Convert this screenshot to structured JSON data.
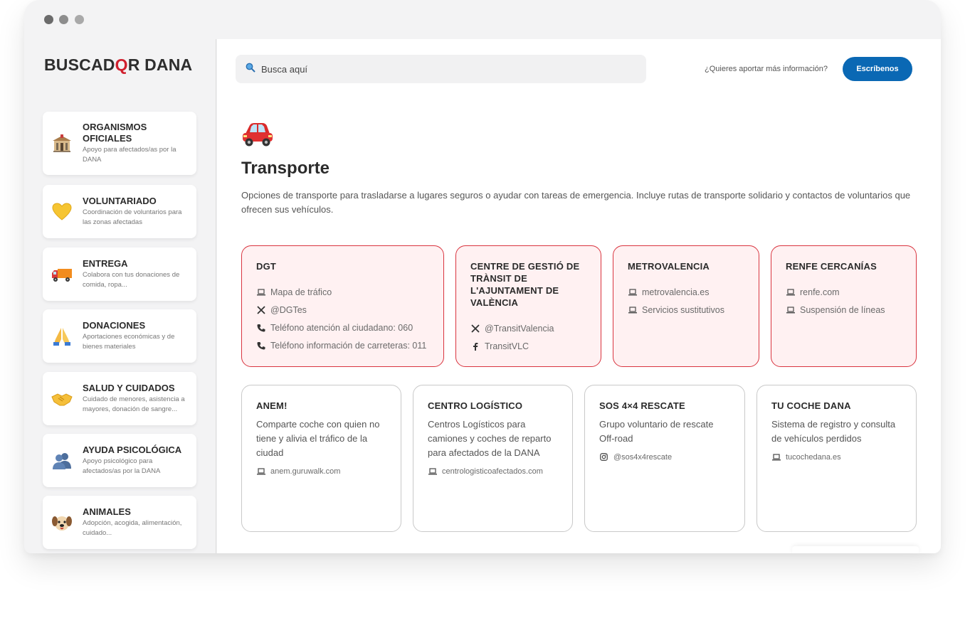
{
  "window": {
    "controls": [
      "close",
      "minimize",
      "maximize"
    ]
  },
  "sidebar": {
    "logo": {
      "before": "BUSCAD",
      "q": "Q",
      "after": "R DANA"
    },
    "items": [
      {
        "title": "ORGANISMOS OFICIALES",
        "desc": "Apoyo para afectados/as por la DANA",
        "icon": "government-building-icon"
      },
      {
        "title": "VOLUNTARIADO",
        "desc": "Coordinación de voluntarios para las zonas afectadas",
        "icon": "yellow-heart-icon"
      },
      {
        "title": "ENTREGA",
        "desc": "Colabora con tus donaciones de comida, ropa...",
        "icon": "delivery-truck-icon"
      },
      {
        "title": "DONACIONES",
        "desc": "Aportaciones económicas y de bienes materiales",
        "icon": "folded-hands-icon"
      },
      {
        "title": "SALUD Y CUIDADOS",
        "desc": "Cuidado de menores, asistencia a mayores, donación de sangre...",
        "icon": "handshake-icon"
      },
      {
        "title": "AYUDA PSICOLÓGICA",
        "desc": "Apoyo psicológico para afectados/as por la DANA",
        "icon": "people-silhouette-icon"
      },
      {
        "title": "ANIMALES",
        "desc": "Adopción, acogida, alimentación, cuidado...",
        "icon": "dog-face-icon"
      }
    ]
  },
  "header": {
    "search_placeholder": "Busca aquí",
    "question": "¿Quieres aportar más información?",
    "cta_label": "Escríbenos"
  },
  "main": {
    "icon": "car-icon",
    "title": "Transporte",
    "description": "Opciones de transporte para trasladarse a lugares seguros o ayudar con tareas de emergencia. Incluye rutas de transporte solidario  y contactos de voluntarios que ofrecen sus vehículos."
  },
  "cards_official": [
    {
      "title": "DGT",
      "links": [
        {
          "icon": "laptop-icon",
          "text": "Mapa de tráfico"
        },
        {
          "icon": "x-logo-icon",
          "text": "@DGTes"
        },
        {
          "icon": "phone-icon",
          "text": "Teléfono atención al ciudadano: 060"
        },
        {
          "icon": "phone-icon",
          "text": "Teléfono información de carreteras: 011"
        }
      ]
    },
    {
      "title": "CENTRE DE GESTIÓ DE TRÀNSIT DE L'AJUNTAMENT DE VALÈNCIA",
      "links": [
        {
          "icon": "x-logo-icon",
          "text": "@TransitValencia"
        },
        {
          "icon": "facebook-icon",
          "text": "TransitVLC"
        }
      ]
    },
    {
      "title": "METROVALENCIA",
      "links": [
        {
          "icon": "laptop-icon",
          "text": "metrovalencia.es"
        },
        {
          "icon": "laptop-icon",
          "text": "Servicios sustitutivos"
        }
      ]
    },
    {
      "title": "RENFE CERCANÍAS",
      "links": [
        {
          "icon": "laptop-icon",
          "text": "renfe.com"
        },
        {
          "icon": "laptop-icon",
          "text": "Suspensión de líneas"
        }
      ]
    }
  ],
  "cards_volunteer": [
    {
      "title": "ANEM!",
      "desc": "Comparte coche con quien no tiene y alivia el tráfico de la ciudad",
      "link": {
        "icon": "laptop-icon",
        "text": "anem.guruwalk.com"
      }
    },
    {
      "title": "CENTRO LOGÍSTICO",
      "desc": "Centros Logísticos para camiones y coches de reparto para afectados de la DANA",
      "link": {
        "icon": "laptop-icon",
        "text": "centrologisticoafectados.com"
      }
    },
    {
      "title": "SOS 4×4 RESCATE",
      "desc": "Grupo voluntario de rescate Off-road",
      "link": {
        "icon": "instagram-icon",
        "text": "@sos4x4rescate"
      }
    },
    {
      "title": "TU COCHE DANA",
      "desc": "Sistema de registro y consulta de vehículos perdidos",
      "link": {
        "icon": "laptop-icon",
        "text": "tucochedana.es"
      }
    }
  ]
}
